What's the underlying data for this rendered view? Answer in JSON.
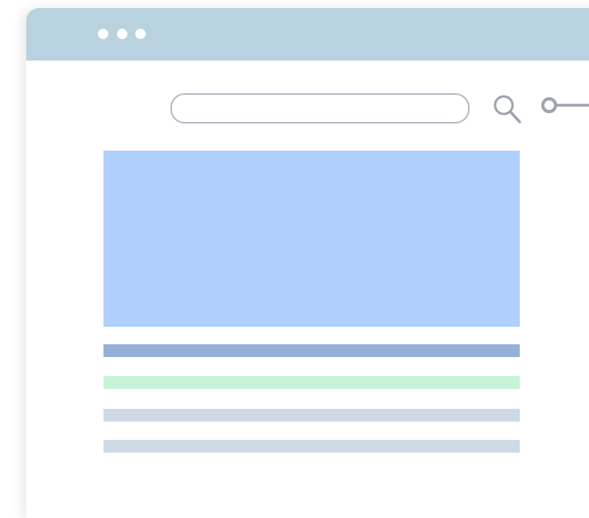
{
  "window": {
    "titlebar_color": "#b8d3df",
    "control_dots": [
      "dot",
      "dot",
      "dot"
    ]
  },
  "search": {
    "placeholder": "",
    "value": "",
    "icon": "search-icon"
  },
  "key": {
    "icon": "key-icon"
  },
  "content": {
    "hero_color": "#afd0fd",
    "lines": [
      {
        "name": "heading-line",
        "color": "#96b0d8"
      },
      {
        "name": "highlight-line",
        "color": "#c7f3d9"
      },
      {
        "name": "text-line",
        "color": "#cfd9e4"
      },
      {
        "name": "text-line",
        "color": "#cfd9e4"
      }
    ]
  }
}
